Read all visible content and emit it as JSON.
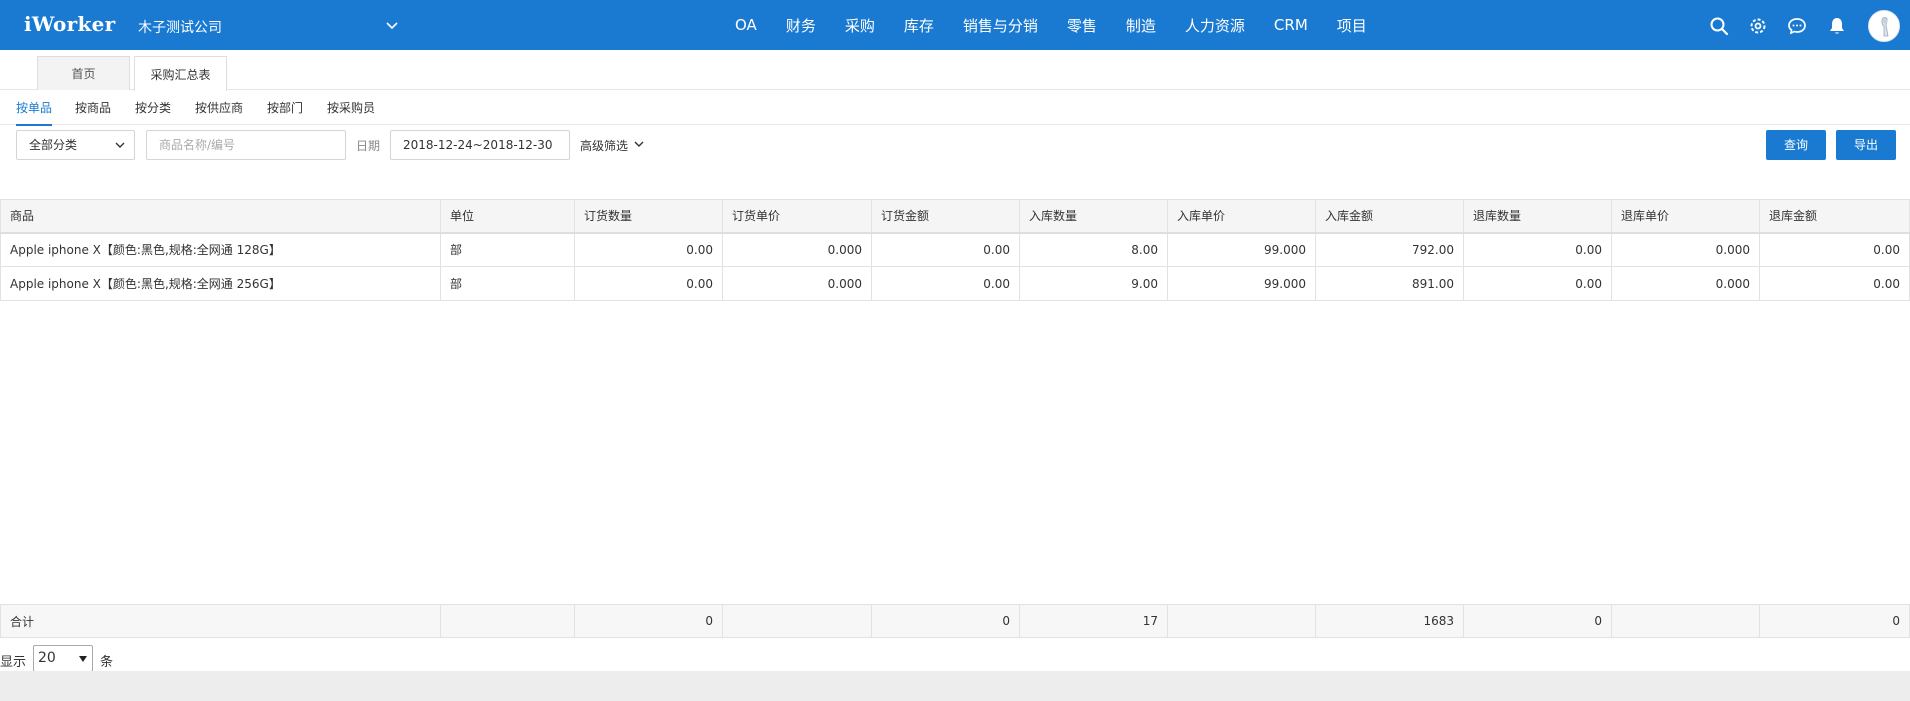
{
  "topbar": {
    "logo": "iWorker",
    "company": "木子测试公司",
    "nav": [
      "OA",
      "财务",
      "采购",
      "库存",
      "销售与分销",
      "零售",
      "制造",
      "人力资源",
      "CRM",
      "项目"
    ],
    "icons": [
      "search-icon",
      "gear-icon",
      "chat-icon",
      "bell-icon",
      "avatar"
    ]
  },
  "page_tabs": [
    {
      "label": "首页",
      "active": false
    },
    {
      "label": "采购汇总表",
      "active": true
    }
  ],
  "sub_tabs": [
    {
      "label": "按单品",
      "active": true
    },
    {
      "label": "按商品",
      "active": false
    },
    {
      "label": "按分类",
      "active": false
    },
    {
      "label": "按供应商",
      "active": false
    },
    {
      "label": "按部门",
      "active": false
    },
    {
      "label": "按采购员",
      "active": false
    }
  ],
  "filters": {
    "category": "全部分类",
    "search_placeholder": "商品名称/编号",
    "date_label": "日期",
    "date_range": "2018-12-24~2018-12-30",
    "advanced": "高级筛选",
    "query_btn": "查询",
    "export_btn": "导出"
  },
  "table": {
    "headers": [
      "商品",
      "单位",
      "订货数量",
      "订货单价",
      "订货金额",
      "入库数量",
      "入库单价",
      "入库金额",
      "退库数量",
      "退库单价",
      "退库金额"
    ],
    "rows": [
      [
        "Apple iphone X【颜色:黑色,规格:全网通 128G】",
        "部",
        "0.00",
        "0.000",
        "0.00",
        "8.00",
        "99.000",
        "792.00",
        "0.00",
        "0.000",
        "0.00"
      ],
      [
        "Apple iphone X【颜色:黑色,规格:全网通 256G】",
        "部",
        "0.00",
        "0.000",
        "0.00",
        "9.00",
        "99.000",
        "891.00",
        "0.00",
        "0.000",
        "0.00"
      ]
    ],
    "total": [
      "合计",
      "",
      "0",
      "",
      "0",
      "17",
      "",
      "1683",
      "0",
      "",
      "0"
    ]
  },
  "pager": {
    "show_label": "显示",
    "page_size": "20",
    "unit_label": "条"
  },
  "colors": {
    "brand": "#1a7ad1",
    "header_bg": "#f5f5f5"
  }
}
